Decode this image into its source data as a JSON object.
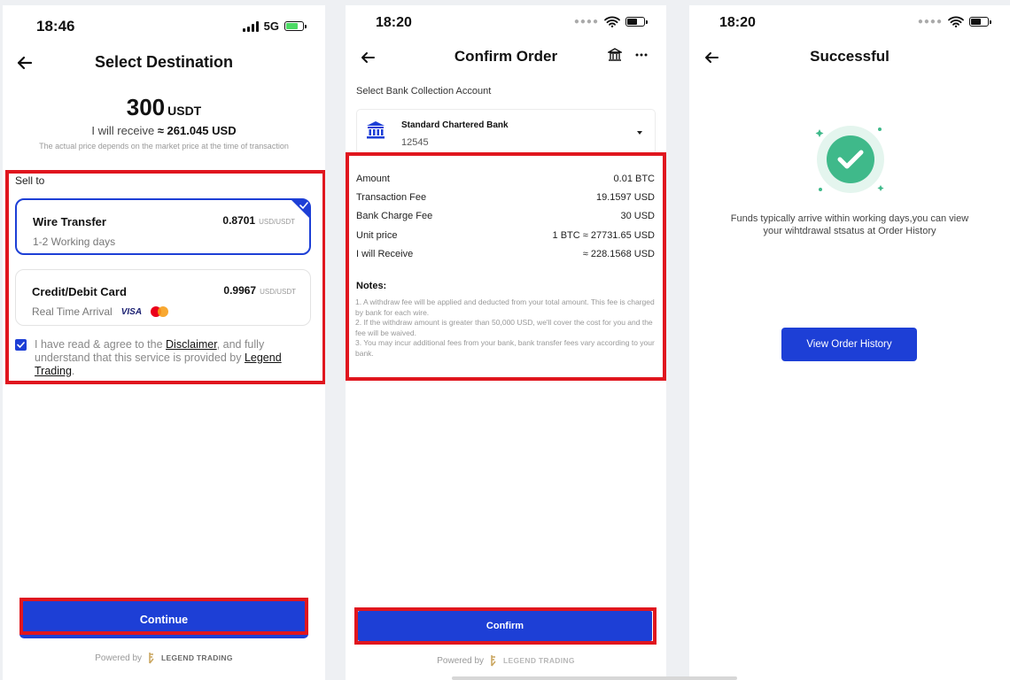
{
  "screen1": {
    "status": {
      "time": "18:46",
      "network": "5G"
    },
    "title": "Select Destination",
    "amount": "300",
    "currency": "USDT",
    "receive_prefix": "I will receive",
    "receive_value": "≈ 261.045 USD",
    "price_note": "The actual price depends on the market price at the time of transaction",
    "sell_to_label": "Sell to",
    "methods": [
      {
        "name": "Wire Transfer",
        "sub": "1-2 Working days",
        "rate": "0.8701",
        "unit": "USD/USDT",
        "selected": true
      },
      {
        "name": "Credit/Debit Card",
        "sub": "Real Time Arrival",
        "rate": "0.9967",
        "unit": "USD/USDT",
        "selected": false,
        "logos": [
          "visa-icon",
          "mastercard-icon"
        ]
      }
    ],
    "visa_label": "VISA",
    "agree": {
      "text1": "I have read & agree to the ",
      "link1": "Disclaimer",
      "text2": ", and fully understand that this service is provided by ",
      "link2": "Legend Trading",
      "text3": "."
    },
    "continue_label": "Continue",
    "powered_by": "Powered by",
    "brand": "LEGEND TRADING"
  },
  "screen2": {
    "status": {
      "time": "18:20"
    },
    "title": "Confirm Order",
    "bank_label": "Select Bank Collection Account",
    "bank_name": "Standard Chartered Bank",
    "bank_number": "12545",
    "rows": [
      {
        "label": "Amount",
        "value": "0.01 BTC"
      },
      {
        "label": "Transaction Fee",
        "value": "19.1597 USD"
      },
      {
        "label": "Bank Charge Fee",
        "value": "30 USD"
      },
      {
        "label": "Unit price",
        "value": "1 BTC ≈ 27731.65 USD"
      },
      {
        "label": "I will Receive",
        "value": "≈ 228.1568 USD"
      }
    ],
    "notes_title": "Notes:",
    "notes": [
      "1. A withdraw fee will be applied and deducted from your total amount. This fee is charged by bank for each wire.",
      "2. If the withdraw amount is greater than 50,000 USD, we'll cover the cost for you and the fee will be waived.",
      "3. You may incur additional fees from your bank, bank transfer fees vary according to your bank."
    ],
    "confirm_label": "Confirm",
    "powered_by": "Powered by",
    "brand": "LEGEND TRADING"
  },
  "screen3": {
    "status": {
      "time": "18:20"
    },
    "title": "Successful",
    "message_line1": "Funds typically arrive within  working days,you can view",
    "message_line2": "your wihtdrawal stsatus at Order History",
    "button_label": "View Order History"
  },
  "colors": {
    "primary": "#1d3fd6",
    "highlight": "#e0161e",
    "success": "#3fb98a"
  }
}
